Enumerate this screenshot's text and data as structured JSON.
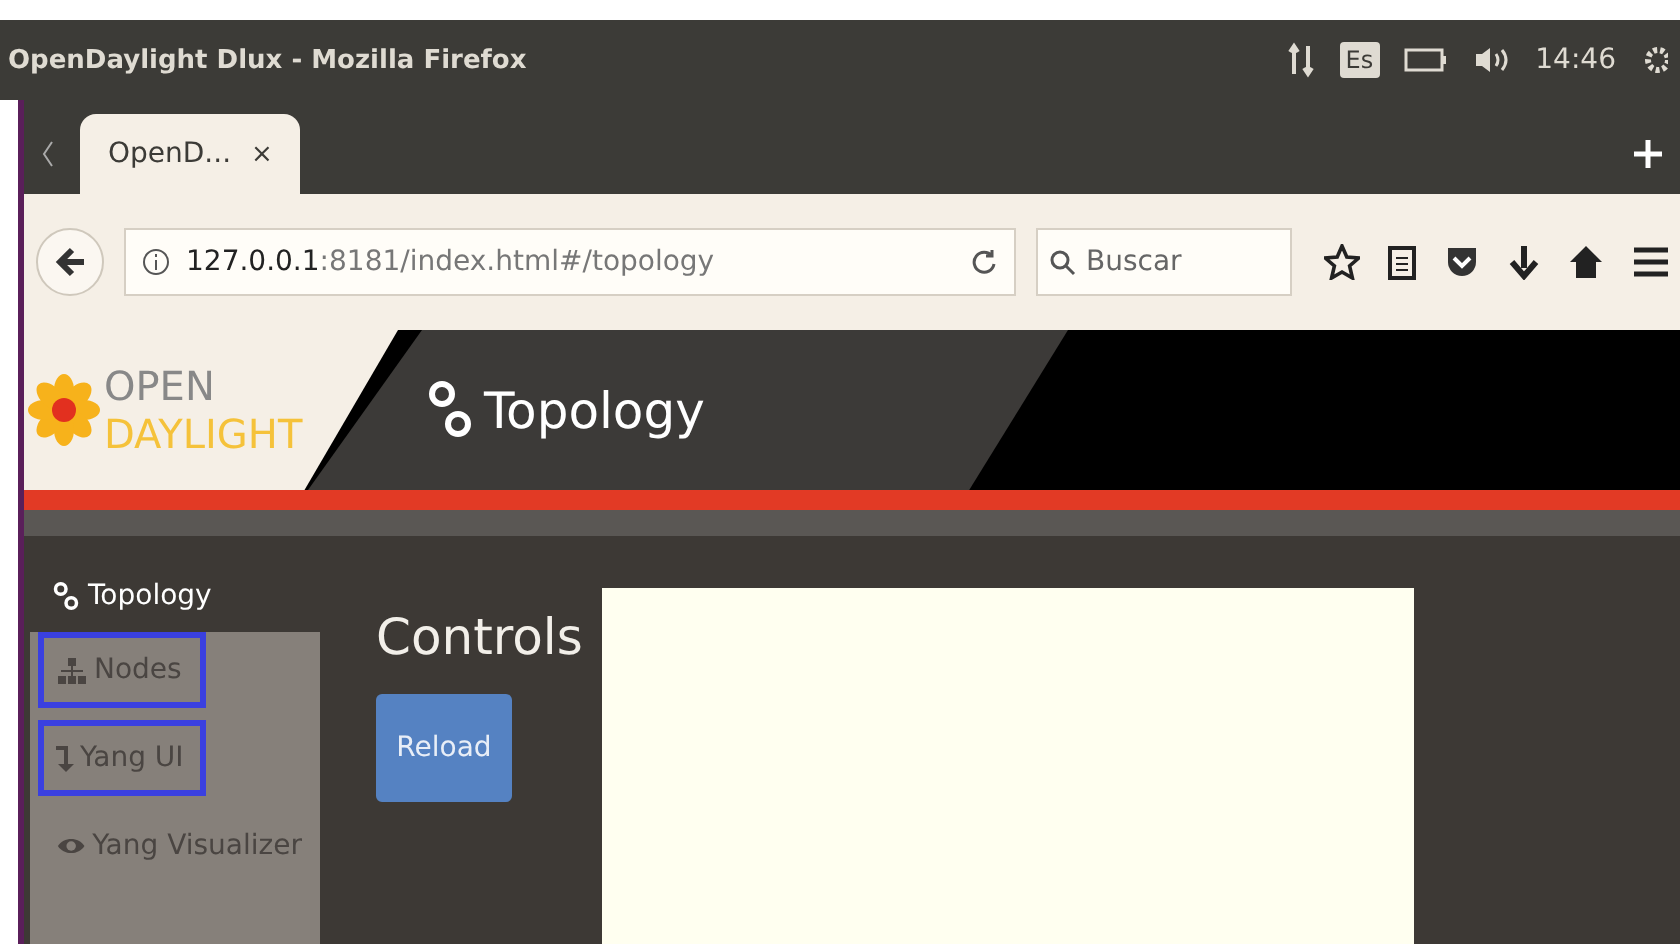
{
  "os_bar": {
    "title": "OpenDaylight Dlux - Mozilla Firefox",
    "keyboard": "Es",
    "time": "14:46"
  },
  "tabs": [
    {
      "label": "OpenD...",
      "close": "×",
      "selected": true
    }
  ],
  "address_bar": {
    "host": "127.0.0.1",
    "rest": ":8181/index.html#/topology"
  },
  "search": {
    "placeholder": "Buscar"
  },
  "app_header": {
    "logo_top": "OPEN",
    "logo_bottom": "DAYLIGHT",
    "title": "Topology"
  },
  "sidebar": {
    "heading": "Topology",
    "items": [
      {
        "label": "Nodes",
        "kind": "sitemap",
        "highlighted": true
      },
      {
        "label": "Yang UI",
        "kind": "arrow",
        "highlighted": true
      },
      {
        "label": "Yang Visualizer",
        "kind": "eye",
        "highlighted": false
      }
    ]
  },
  "main": {
    "heading": "Controls",
    "reload_button": "Reload"
  }
}
